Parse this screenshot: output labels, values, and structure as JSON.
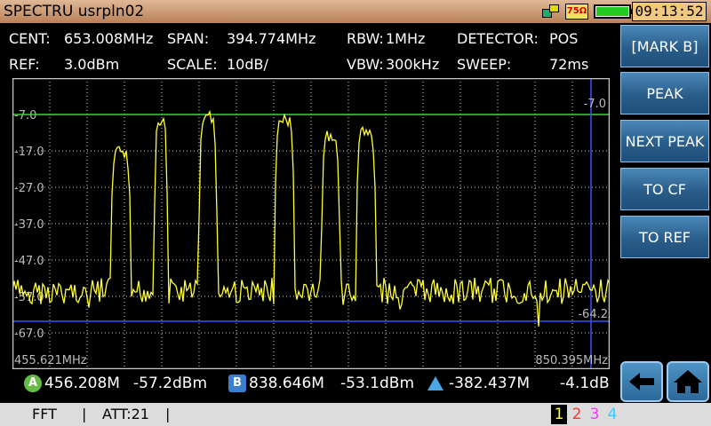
{
  "title": "SPECTRU usrpln02",
  "status": {
    "ohm": "75Ω",
    "clock": "09:13:52"
  },
  "params": {
    "cent_label": "CENT:",
    "cent_value": "653.008MHz",
    "span_label": "SPAN:",
    "span_value": "394.774MHz",
    "rbw_label": "RBW:",
    "rbw_value": "1MHz",
    "detector_label": "DETECTOR:",
    "detector_value": "POS",
    "ref_label": "REF:",
    "ref_value": "3.0dBm",
    "scale_label": "SCALE:",
    "scale_value": "10dB/",
    "vbw_label": "VBW:",
    "vbw_value": "300kHz",
    "sweep_label": "SWEEP:",
    "sweep_value": "72ms"
  },
  "graph": {
    "y_labels": [
      "-7.0",
      "-17.0",
      "-27.0",
      "-37.0",
      "-47.0",
      "-57.0",
      "-67.0"
    ],
    "x_start": "455.621MHz",
    "x_end": "850.395MHz",
    "line_top_label": "-7.0",
    "line_bottom_label": "-64.2",
    "colors": {
      "trace": "#ffff33",
      "grid": "#d8d8d8",
      "border": "#c8c8c8",
      "line_top": "#44cc44",
      "line_bottom": "#3355ff"
    }
  },
  "buttons": {
    "mark_b": "[MARK B]",
    "peak": "PEAK",
    "next_peak": "NEXT PEAK",
    "to_cf": "TO CF",
    "to_ref": "TO REF"
  },
  "nav": {
    "back_icon": "left-arrow-icon",
    "home_icon": "home-icon"
  },
  "markers": {
    "a_badge": "A",
    "a_freq": "456.208M",
    "a_level": "-57.2dBm",
    "b_badge": "B",
    "b_freq": "838.646M",
    "b_level": "-53.1dBm",
    "delta_freq": "-382.437M",
    "delta_level": "-4.1dB"
  },
  "bottom": {
    "mode": "FFT",
    "sep1": "|",
    "att": "ATT:21",
    "sep2": "|",
    "traces": [
      "1",
      "2",
      "3",
      "4"
    ],
    "trace_colors": [
      "#ffff33",
      "#ff3333",
      "#ff33ff",
      "#33ccff"
    ]
  }
}
